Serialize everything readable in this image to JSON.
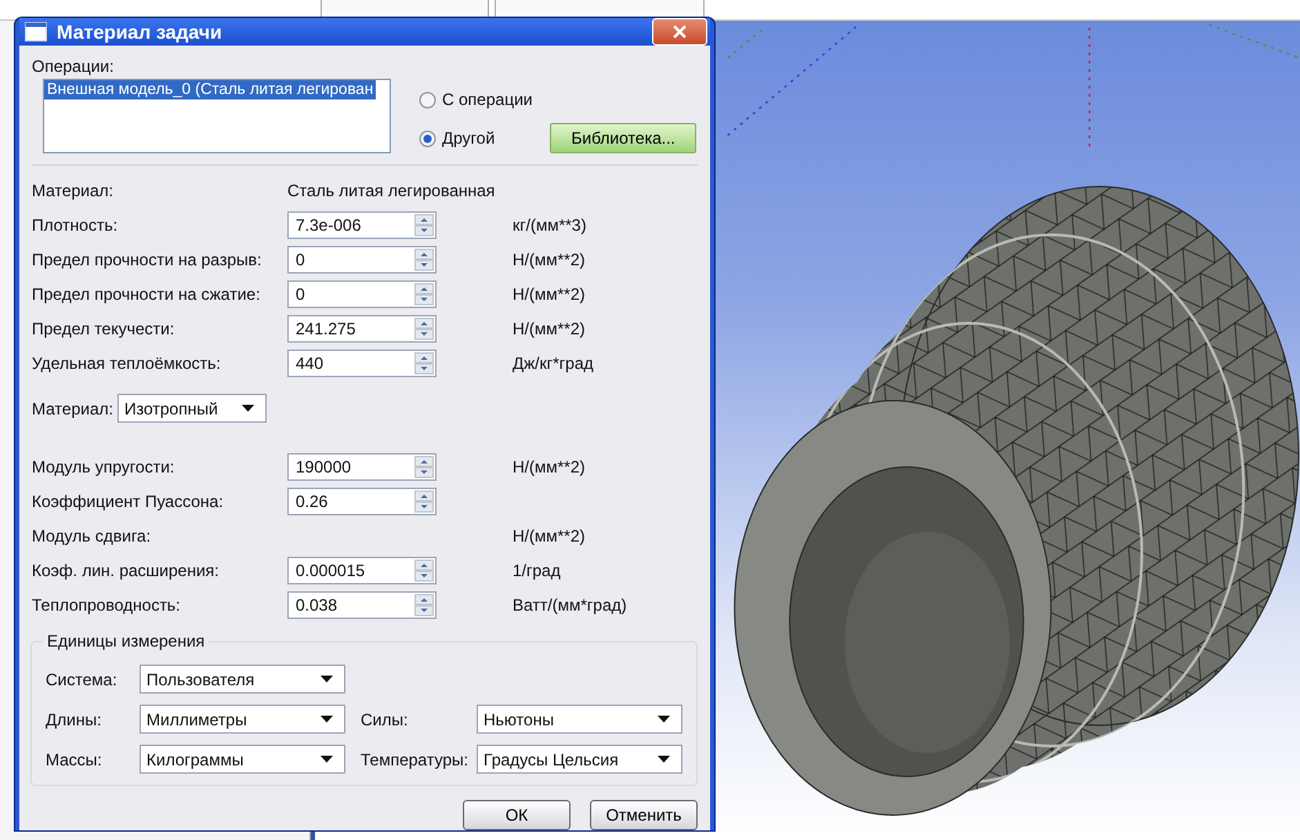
{
  "window": {
    "title": "Материал задачи"
  },
  "operations": {
    "label": "Операции:",
    "items": [
      {
        "text": "Внешная модель_0 (Сталь литая легирован",
        "selected": true
      }
    ]
  },
  "source_options": [
    {
      "label": "С операции",
      "selected": false
    },
    {
      "label": "Другой",
      "selected": true
    }
  ],
  "library_button": "Библиотека...",
  "material": {
    "label": "Материал:",
    "value": "Сталь литая легированная"
  },
  "properties": [
    {
      "kind": "spin",
      "label": "Плотность:",
      "value": "7.3e-006",
      "unit": "кг/(мм**3)"
    },
    {
      "kind": "spin",
      "label": "Предел прочности на разрыв:",
      "value": "0",
      "unit": "Н/(мм**2)"
    },
    {
      "kind": "spin",
      "label": "Предел прочности на сжатие:",
      "value": "0",
      "unit": "Н/(мм**2)"
    },
    {
      "kind": "spin",
      "label": "Предел текучести:",
      "value": "241.275",
      "unit": "Н/(мм**2)"
    },
    {
      "kind": "spin",
      "label": "Удельная теплоёмкость:",
      "value": "440",
      "unit": "Дж/кг*град"
    }
  ],
  "material_type": {
    "label": "Материал:",
    "value": "Изотропный"
  },
  "elastic_properties": [
    {
      "kind": "spin",
      "label": "Модуль упругости:",
      "value": "190000",
      "unit": "Н/(мм**2)"
    },
    {
      "kind": "spin",
      "label": "Коэффициент Пуассона:",
      "value": "0.26"
    },
    {
      "kind": "plain",
      "label": "Модуль сдвига:",
      "unit": "Н/(мм**2)"
    },
    {
      "kind": "spin",
      "label": "Коэф. лин. расширения:",
      "value": "0.000015",
      "unit": "1/град"
    },
    {
      "kind": "spin",
      "label": "Теплопроводность:",
      "value": "0.038",
      "unit": "Ватт/(мм*град)"
    }
  ],
  "units": {
    "title": "Единицы измерения",
    "system": {
      "label": "Система:",
      "value": "Пользователя"
    },
    "fields": [
      {
        "label": "Длины:",
        "value": "Миллиметры"
      },
      {
        "label": "Силы:",
        "value": "Ньютоны"
      },
      {
        "label": "Массы:",
        "value": "Килограммы"
      },
      {
        "label": "Температуры:",
        "value": "Градусы Цельсия"
      }
    ]
  },
  "buttons": [
    {
      "label": "ОК"
    },
    {
      "label": "Отменить"
    }
  ]
}
